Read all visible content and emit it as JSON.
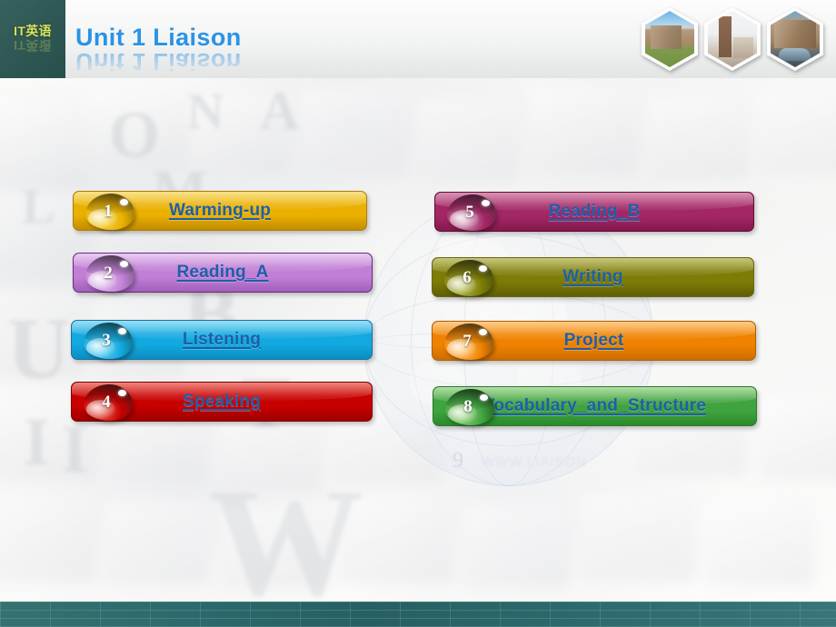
{
  "header": {
    "logo_label": "IT英语",
    "title": "Unit 1 Liaison",
    "thumbnails": [
      {
        "name": "campus-cathedral-photo"
      },
      {
        "name": "clock-tower-photo"
      },
      {
        "name": "campus-street-photo"
      }
    ]
  },
  "background": {
    "watermark_number": "9",
    "watermark_text": "WWW.LIAISON",
    "letters": [
      "O",
      "N",
      "A",
      "M",
      "L",
      "B",
      "U",
      "W",
      "T",
      "I",
      "I"
    ]
  },
  "menu": {
    "left_column": [
      {
        "number": "1",
        "label": "Warming-up",
        "color": "#eab000",
        "color_dark": "#c08b00",
        "color_light": "#f7cf3e",
        "border": "#b07d00",
        "drop_top": "#7e6a12",
        "drop_bottom": "#f3d84f"
      },
      {
        "number": "2",
        "label": "Reading_A",
        "color": "#c180d6",
        "color_dark": "#a05fba",
        "color_light": "#dcabe8",
        "border": "#6b2a7d",
        "drop_top": "#6a5570",
        "drop_bottom": "#e2c3ec"
      },
      {
        "number": "3",
        "label": "Listening",
        "color": "#12a9e0",
        "color_dark": "#0a8ec0",
        "color_light": "#59ccf2",
        "border": "#1d6fa0",
        "drop_top": "#11606f",
        "drop_bottom": "#6fd7f3"
      },
      {
        "number": "4",
        "label": "Speaking",
        "color": "#c80000",
        "color_dark": "#9d0000",
        "color_light": "#e53a2a",
        "border": "#7d0000",
        "drop_top": "#5a1411",
        "drop_bottom": "#e86a5c"
      }
    ],
    "right_column": [
      {
        "number": "5",
        "label": "Reading_B",
        "color": "#a32765",
        "color_dark": "#85184d",
        "color_light": "#c24f88",
        "border": "#5d0d2f",
        "drop_top": "#5a2640",
        "drop_bottom": "#d8a5bf"
      },
      {
        "number": "6",
        "label": "Writing",
        "color": "#7d7c06",
        "color_dark": "#5f5e04",
        "color_light": "#a3a22a",
        "border": "#676612",
        "drop_top": "#3d4a12",
        "drop_bottom": "#b9c45a"
      },
      {
        "number": "7",
        "label": "Project",
        "color": "#ef8200",
        "color_dark": "#cc6d00",
        "color_light": "#ffab3d",
        "border": "#b05e00",
        "drop_top": "#6b4a16",
        "drop_bottom": "#ffc164"
      },
      {
        "number": "8",
        "label": "Vocabulary_and_Structure",
        "color": "#3fa33f",
        "color_dark": "#2b8a2b",
        "color_light": "#7fc86b",
        "border": "#2c7a2c",
        "drop_top": "#1d4a1d",
        "drop_bottom": "#9fd784"
      }
    ]
  },
  "colors": {
    "header_logo_bg": "#2f5753",
    "title_blue": "#2a93e4",
    "logo_yellow": "#d7e35a",
    "footer_teal": "#2c6a6d",
    "link_text": "#1d5fa8"
  }
}
